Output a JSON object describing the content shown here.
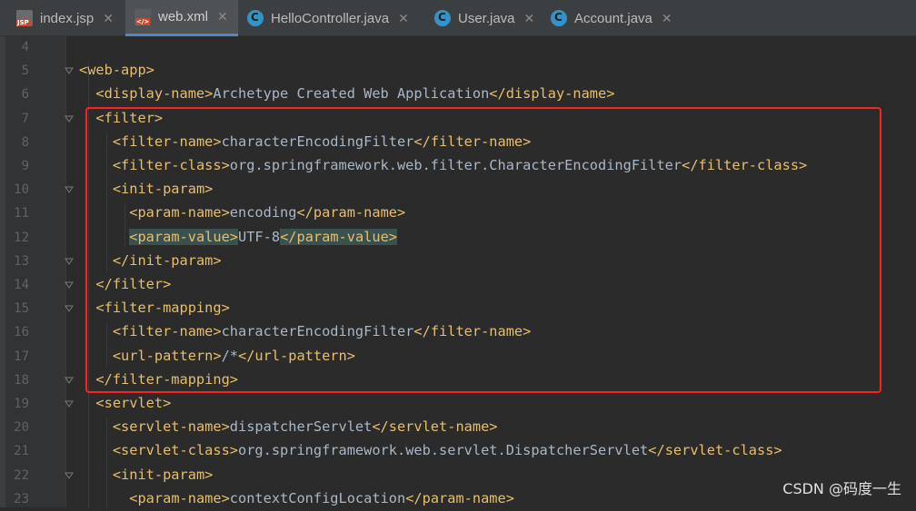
{
  "tabs": [
    {
      "label": "index.jsp",
      "icon": "jsp-file-icon",
      "active": false
    },
    {
      "label": "web.xml",
      "icon": "xml-file-icon",
      "active": true
    },
    {
      "label": "HelloController.java",
      "icon": "java-class-icon",
      "active": false
    },
    {
      "label": "User.java",
      "icon": "java-class-icon",
      "active": false
    },
    {
      "label": "Account.java",
      "icon": "java-class-icon",
      "active": false
    }
  ],
  "close_glyph": "✕",
  "lines": [
    {
      "n": "4",
      "code": ""
    },
    {
      "n": "5",
      "code": "<web-app>"
    },
    {
      "n": "6",
      "code": "  <display-name>Archetype Created Web Application</display-name>"
    },
    {
      "n": "7",
      "code": "  <filter>"
    },
    {
      "n": "8",
      "code": "    <filter-name>characterEncodingFilter</filter-name>"
    },
    {
      "n": "9",
      "code": "    <filter-class>org.springframework.web.filter.CharacterEncodingFilter</filter-class>"
    },
    {
      "n": "10",
      "code": "    <init-param>"
    },
    {
      "n": "11",
      "code": "      <param-name>encoding</param-name>"
    },
    {
      "n": "12",
      "code": "      <param-value>UTF-8</param-value>"
    },
    {
      "n": "13",
      "code": "    </init-param>"
    },
    {
      "n": "14",
      "code": "  </filter>"
    },
    {
      "n": "15",
      "code": "  <filter-mapping>"
    },
    {
      "n": "16",
      "code": "    <filter-name>characterEncodingFilter</filter-name>"
    },
    {
      "n": "17",
      "code": "    <url-pattern>/*</url-pattern>"
    },
    {
      "n": "18",
      "code": "  </filter-mapping>"
    },
    {
      "n": "19",
      "code": "  <servlet>"
    },
    {
      "n": "20",
      "code": "    <servlet-name>dispatcherServlet</servlet-name>"
    },
    {
      "n": "21",
      "code": "    <servlet-class>org.springframework.web.servlet.DispatcherServlet</servlet-class>"
    },
    {
      "n": "22",
      "code": "    <init-param>"
    },
    {
      "n": "23",
      "code": "      <param-name>contextConfigLocation</param-name>"
    }
  ],
  "watermark": "CSDN @码度一生",
  "colors": {
    "tag": "#e8bf6a",
    "text": "#a9b7c6",
    "highlight_box": "#ff2020",
    "background": "#2b2b2b"
  }
}
